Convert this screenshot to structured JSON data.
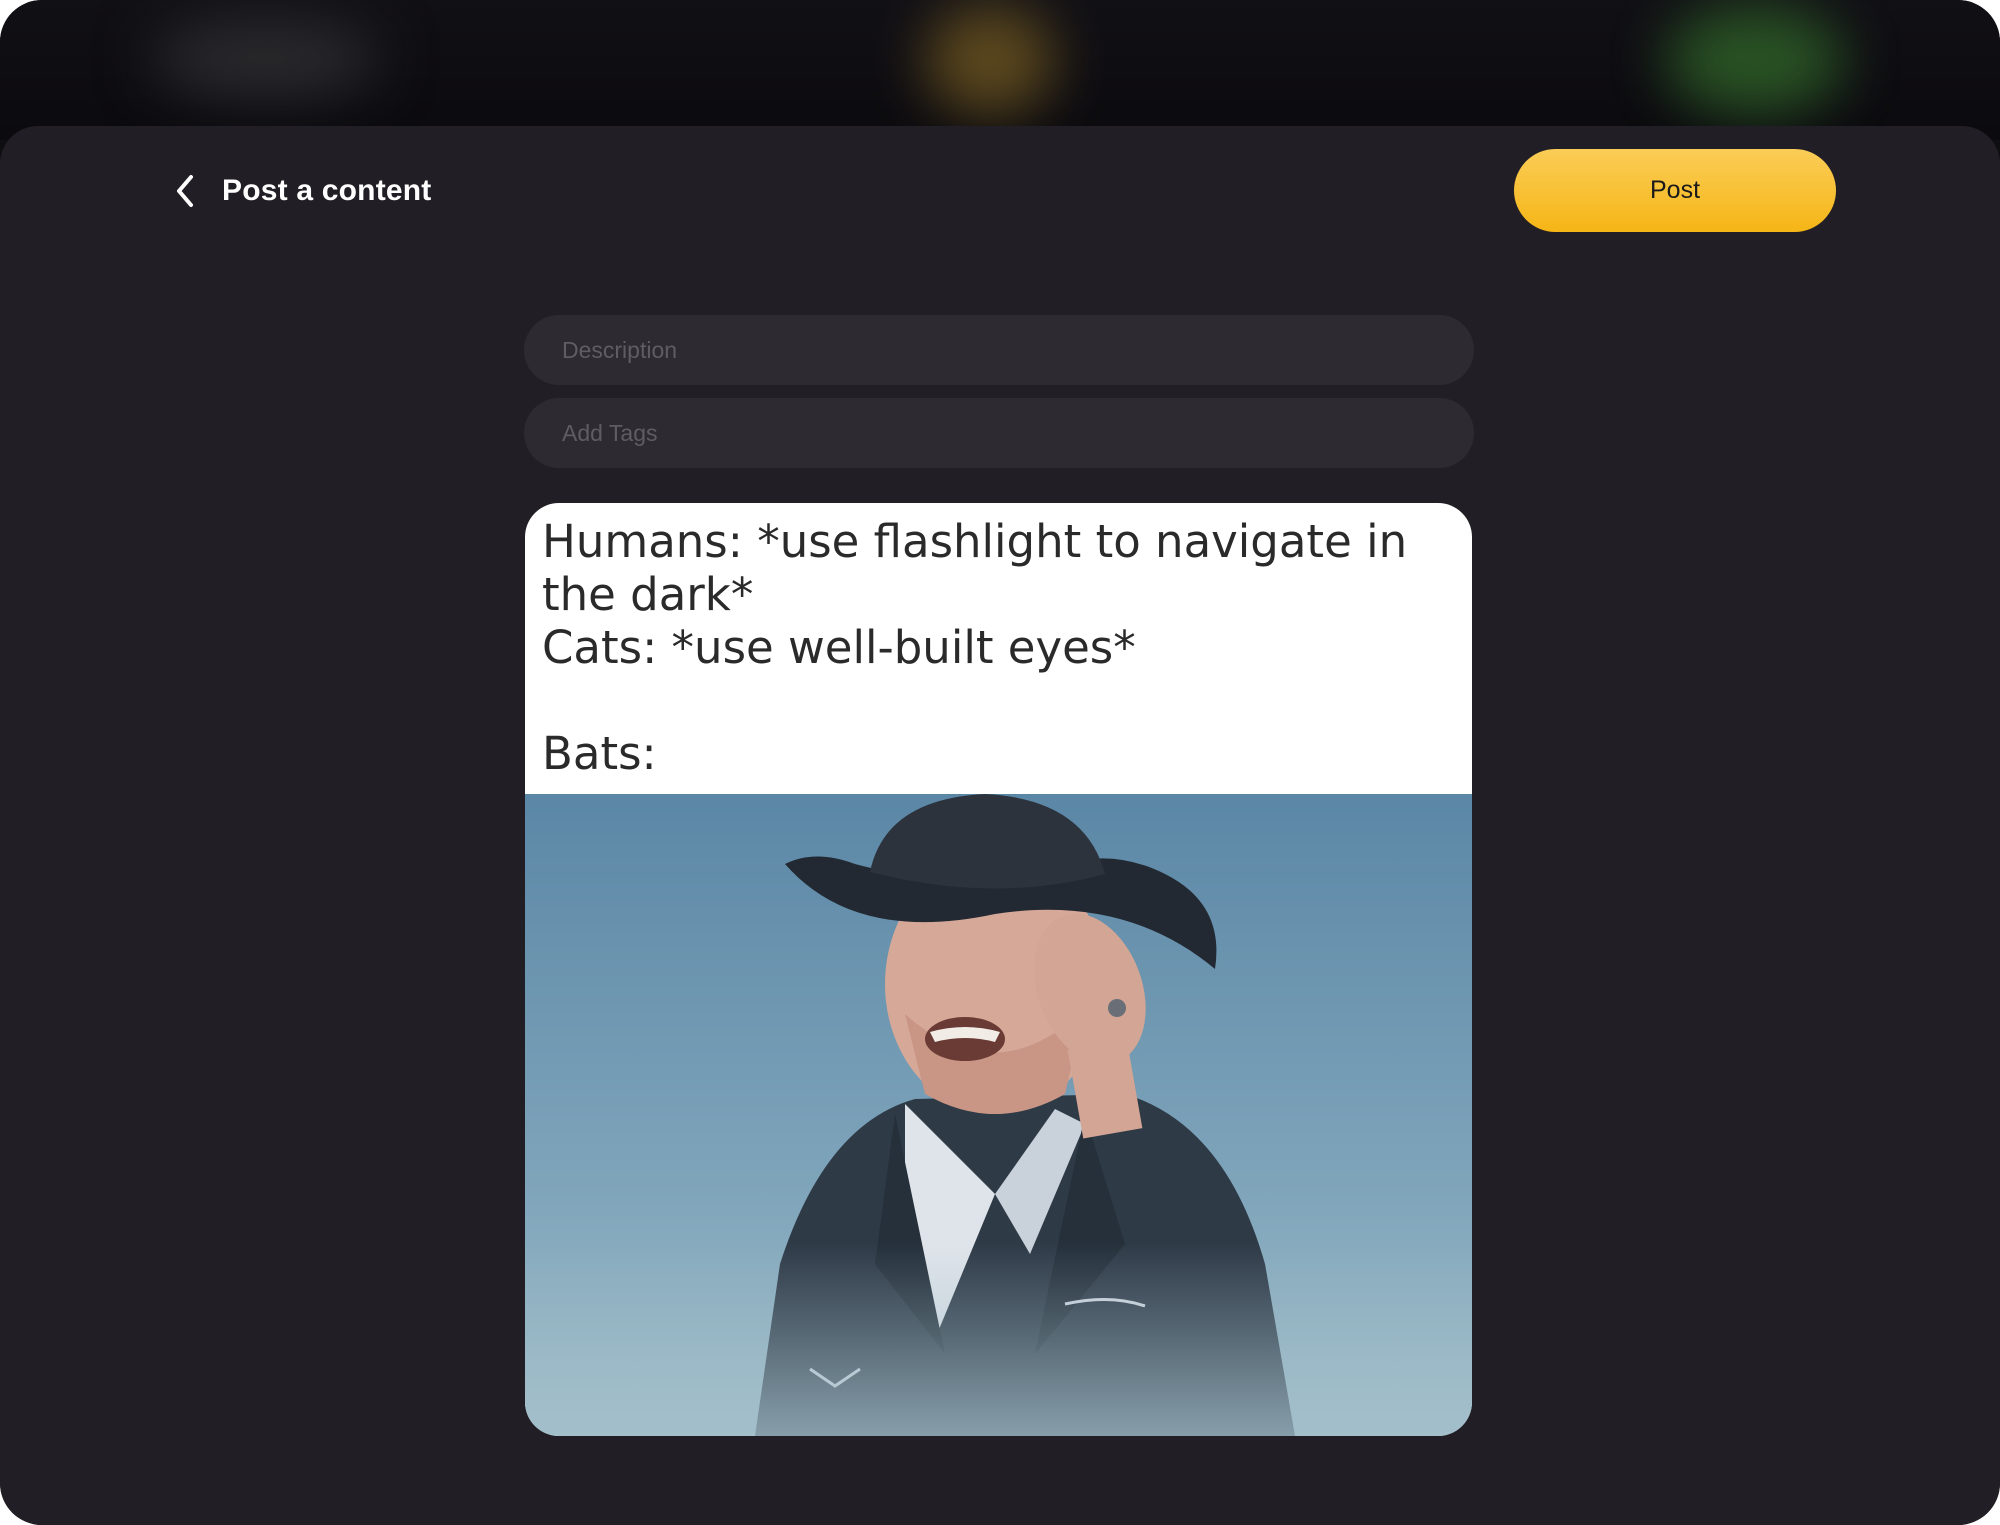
{
  "header": {
    "title": "Post a content",
    "post_label": "Post"
  },
  "form": {
    "description_placeholder": "Description",
    "tags_placeholder": "Add Tags"
  },
  "media": {
    "caption": "Humans: *use flashlight to navigate in the dark*\nCats: *use well-built eyes*\n\nBats:"
  },
  "colors": {
    "accent": "#f5b516",
    "sheet_background": "#211f25",
    "field_background": "#2d2b31"
  },
  "icons": {
    "back": "chevron-left-icon"
  }
}
